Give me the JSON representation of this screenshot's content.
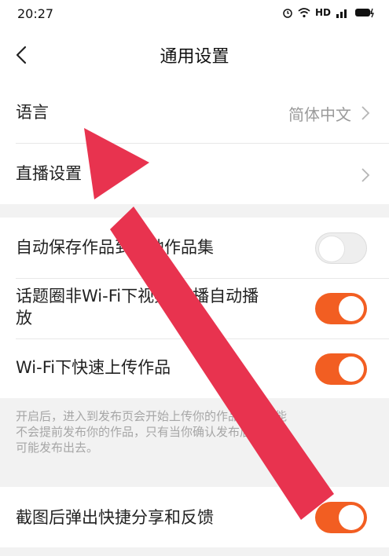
{
  "status": {
    "time": "20:27",
    "icons": [
      "alarm-icon",
      "wifi-icon",
      "hd-icon",
      "signal-icon",
      "battery-icon"
    ],
    "hd": "HD"
  },
  "header": {
    "title": "通用设置"
  },
  "settings": {
    "language_label": "语言",
    "language_value": "简体中文",
    "live_label": "直播设置",
    "autosave_label": "自动保存作品到本地作品集",
    "autoplay_label": "话题圈非Wi-Fi下视频/直播自动播放",
    "autoplay_label_line1": "话题圈非Wi-Fi下视频/直播自动播",
    "autoplay_label_line2": "放",
    "fastupload_label": "Wi-Fi下快速上传作品",
    "fastupload_hint": "开启后，进入到发布页会开始上传你的作品；该功能不会提前发布你的作品，只有当你确认发布后作品才可能发布出去。",
    "fastupload_hint_line1": "开启后，进入到发布页会开始上传你的作品；该功能",
    "fastupload_hint_line2": "不会提前发布你的作品，只有当你确认发布后作品才",
    "fastupload_hint_line3": "可能发布出去。",
    "screenshot_label": "截图后弹出快捷分享和反馈"
  },
  "toggles": {
    "autosave": false,
    "autoplay": true,
    "fastupload": true,
    "screenshot": true
  },
  "colors": {
    "accent": "#f25e22",
    "arrow": "#e8334f"
  }
}
